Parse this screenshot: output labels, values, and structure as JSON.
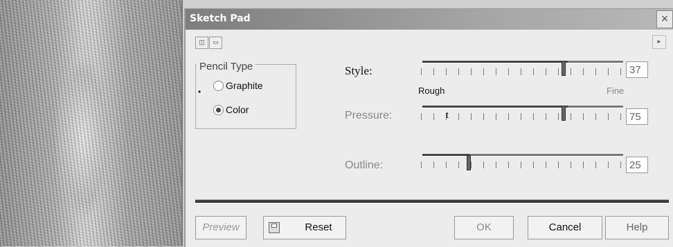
{
  "dialog": {
    "title": "Sketch Pad",
    "close_icon": "close-icon"
  },
  "pencil_type": {
    "legend": "Pencil Type",
    "bullet": "•",
    "options": [
      {
        "label": "Graphite",
        "selected": false
      },
      {
        "label": "Color",
        "selected": true
      }
    ]
  },
  "sliders": {
    "style": {
      "label": "Style:",
      "value": "37",
      "level": 0.72,
      "min_label": "Rough",
      "max_label": "Fine"
    },
    "pressure": {
      "label": "Pressure:",
      "value": "75",
      "level": 0.72,
      "marker": "t"
    },
    "outline": {
      "label": "Outline:",
      "value": "25",
      "level": 0.25
    }
  },
  "buttons": {
    "preview": "Preview",
    "reset": "Reset",
    "ok": "OK",
    "cancel": "Cancel",
    "help": "Help"
  },
  "toolbar": {
    "expand": "▸"
  }
}
